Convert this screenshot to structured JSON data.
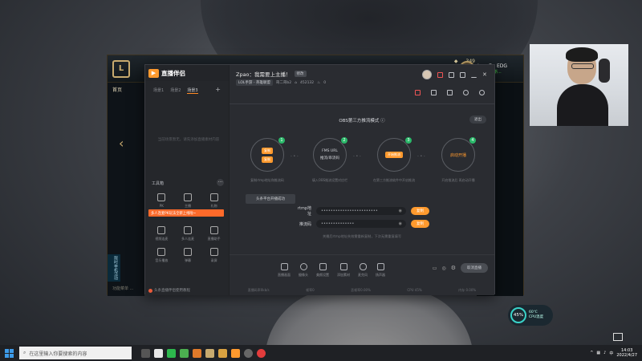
{
  "game": {
    "home_label": "首页",
    "stat_value": "349",
    "friend_name": "Love7 - EDG",
    "friend_status": "鏖战海克斯...",
    "badge_text": "限时单机活动",
    "bottom_text": "功能菜单 ..."
  },
  "app": {
    "name": "直播伴侣",
    "tabs": [
      "场景1",
      "场景2",
      "场景3"
    ],
    "add_tab": "+",
    "empty_hint": "当前场景暂无，请先添加直播素材内容",
    "toolbox_title": "工具箱",
    "toolbox_more": "···",
    "banner": "多人连麦PK玩法全新上线啦~",
    "tools": [
      {
        "label": "PK"
      },
      {
        "label": "主播"
      },
      {
        "label": "礼物"
      },
      {
        "label": "视频连麦"
      },
      {
        "label": "多人连麦"
      },
      {
        "label": "直播助手"
      },
      {
        "label": "音乐播放"
      },
      {
        "label": "弹幕"
      },
      {
        "label": "录屏"
      }
    ],
    "left_footer": "头条直播伴侣使用教程",
    "room_title": "Zpao：我需要上主播！",
    "edit_label": "修改",
    "category": "LOL手游 - 英雄联盟",
    "room_info": "哥二哥b2",
    "room_id": "452132",
    "likes": "0",
    "obs_title": "OBS第三方推流模式",
    "exit_label": "退出",
    "steps": [
      {
        "num": "1",
        "top": "复制",
        "mid": "",
        "desc": "复制rtmp地址和推流码"
      },
      {
        "num": "2",
        "top": "FMS URL",
        "mid": "推流/串流码",
        "desc": "填入OBS推流设置对应栏"
      },
      {
        "num": "3",
        "top": "开始推流",
        "mid": "",
        "desc": "在第三方推流软件中开启推流"
      },
      {
        "num": "4",
        "top": "启动开播",
        "mid": "",
        "desc": "开启推流后 再启动开播"
      }
    ],
    "sync_button": "头条平台开播成功",
    "rtmp_label": "rtmp地址",
    "rtmp_value": "••••••••••••••••••••••••",
    "key_label": "推流码",
    "key_value": "••••••••••••••",
    "copy_label": "复制",
    "hint": "关播后rtmp地址失效需重新复制，下次无需重复填写",
    "bottom_items": [
      "直播画面",
      "摄像头",
      "美颜设置",
      "添加素材",
      "麦克风",
      "扬声器"
    ],
    "start_live": "取消直播",
    "status": [
      "直播码率0kb/s",
      "帧率0",
      "丢帧率0.00%",
      "CPU 45%",
      "内存 0.00%"
    ]
  },
  "cpu": {
    "percent": "45%",
    "temp": "60℃",
    "label": "CPU温度"
  },
  "taskbar": {
    "search_placeholder": "在这里输入你要搜索的内容",
    "time": "14:03",
    "date": "2022/4/27",
    "lang": "中"
  },
  "colors": {
    "accent": "#ff9a2e",
    "step_done": "#2bb96a",
    "banner": "#ff6a2a",
    "win_blue": "#3d9be9"
  }
}
